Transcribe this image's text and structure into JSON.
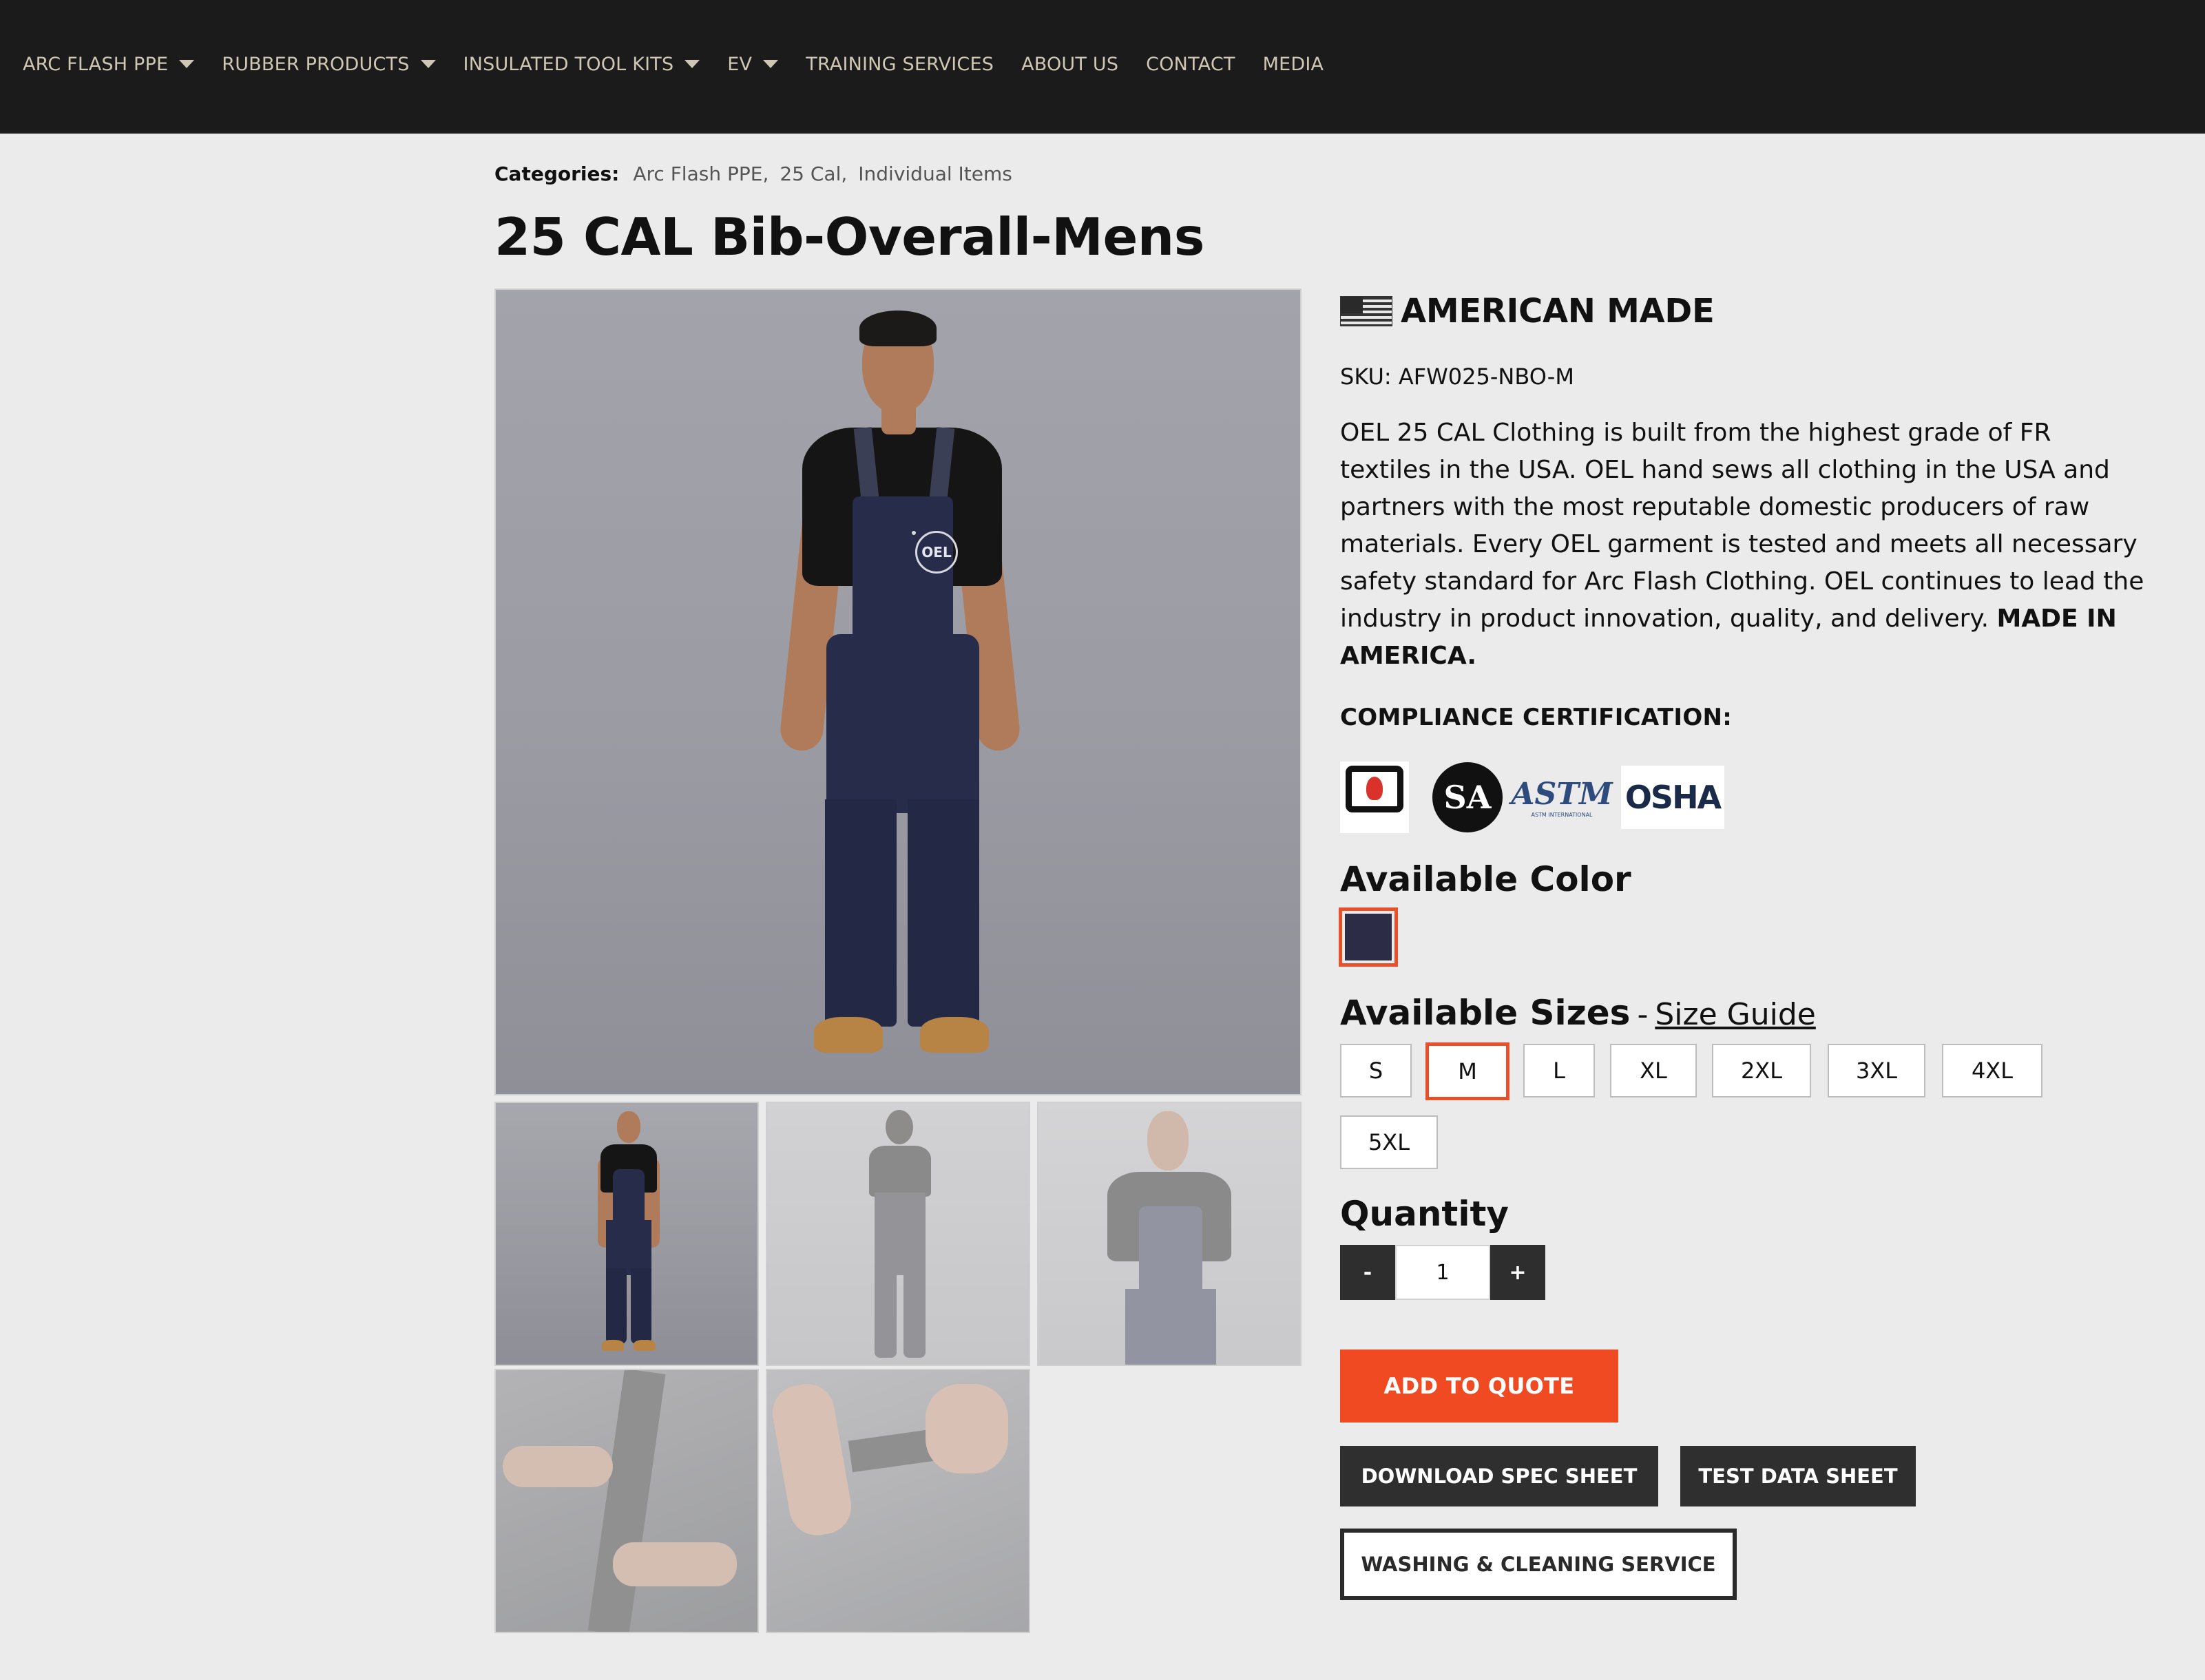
{
  "nav": {
    "items": [
      {
        "label": "ARC FLASH PPE",
        "has_dropdown": true
      },
      {
        "label": "RUBBER PRODUCTS",
        "has_dropdown": true
      },
      {
        "label": "INSULATED TOOL KITS",
        "has_dropdown": true
      },
      {
        "label": "EV",
        "has_dropdown": true
      },
      {
        "label": "TRAINING SERVICES",
        "has_dropdown": false
      },
      {
        "label": "ABOUT US",
        "has_dropdown": false
      },
      {
        "label": "CONTACT",
        "has_dropdown": false
      },
      {
        "label": "MEDIA",
        "has_dropdown": false
      }
    ]
  },
  "breadcrumb": {
    "label": "Categories:",
    "links": [
      "Arc Flash PPE,",
      "25 Cal,",
      "Individual Items"
    ]
  },
  "product": {
    "title": "25 CAL Bib-Overall-Mens",
    "origin_badge": "AMERICAN MADE",
    "sku": "SKU: AFW025-NBO-M",
    "description": "OEL 25 CAL Clothing is built from the highest grade of FR textiles in the USA. OEL hand sews all clothing in the USA and partners with the most reputable domestic producers of raw materials. Every OEL garment is tested and meets all necessary safety standard for Arc Flash Clothing. OEL continues to lead the industry in product innovation, quality, and delivery.",
    "description_emphasis": "MADE IN AMERICA.",
    "compliance_heading": "COMPLIANCE CERTIFICATION:",
    "certifications": [
      "NFPA",
      "CSA",
      "ASTM",
      "OSHA"
    ],
    "color_heading": "Available Color",
    "colors": [
      {
        "name": "navy",
        "hex": "#2c2c46",
        "selected": true
      }
    ],
    "sizes_heading": "Available Sizes",
    "sizes_separator": "-",
    "size_guide_label": "Size Guide",
    "sizes": [
      "S",
      "M",
      "L",
      "XL",
      "2XL",
      "3XL",
      "4XL",
      "5XL"
    ],
    "selected_size": "M",
    "quantity_heading": "Quantity",
    "quantity_minus": "-",
    "quantity_plus": "+",
    "quantity_value": "1",
    "buttons": {
      "add_to_quote": "ADD TO QUOTE",
      "download_spec": "DOWNLOAD SPEC SHEET",
      "test_data": "TEST DATA SHEET",
      "washing": "WASHING & CLEANING SERVICE"
    }
  },
  "gallery": {
    "main_image": "man-in-navy-bib-overall-front",
    "thumbnails": [
      "front-full",
      "back-view",
      "front-closeup",
      "strap-buckle-detail",
      "pocket-detail"
    ]
  },
  "logo_text": {
    "oel": "OEL",
    "csa_mark": "SA",
    "astm_mark": "ASTM",
    "astm_sub": "ASTM INTERNATIONAL",
    "nfpa_mark": "NFPA",
    "osha_mark": "OSHA"
  },
  "colors": {
    "accent": "#f04a22",
    "nav_bg": "#1b1b1b",
    "nav_text": "#cfc6b3",
    "dark_button": "#2f2f2f",
    "page_bg": "#ebebeb"
  }
}
